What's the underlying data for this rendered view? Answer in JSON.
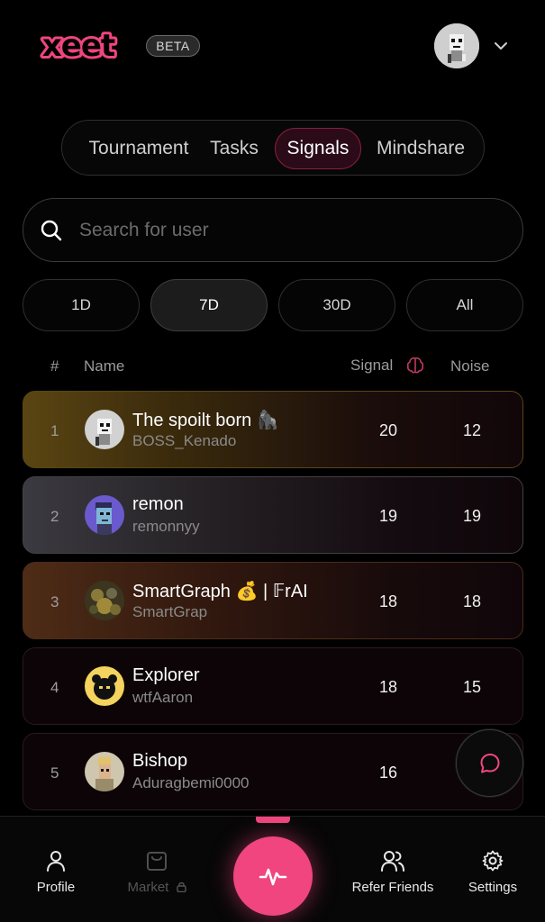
{
  "header": {
    "logo_text": "xeet",
    "beta_label": "BETA",
    "brand_color": "#f0457e",
    "user_avatar_icon": "pixel-skull-avatar",
    "menu_icon": "chevron-down-icon"
  },
  "tabs": [
    {
      "label": "Tournament",
      "active": false
    },
    {
      "label": "Tasks",
      "active": false
    },
    {
      "label": "Signals",
      "active": true
    },
    {
      "label": "Mindshare",
      "active": false
    }
  ],
  "search": {
    "placeholder": "Search for user",
    "value": ""
  },
  "periods": [
    {
      "label": "1D",
      "active": false
    },
    {
      "label": "7D",
      "active": true
    },
    {
      "label": "30D",
      "active": false
    },
    {
      "label": "All",
      "active": false
    }
  ],
  "table": {
    "columns": {
      "rank": "#",
      "name": "Name",
      "signal": "Signal",
      "noise": "Noise"
    },
    "signal_icon": "brain-icon",
    "rows": [
      {
        "rank": "1",
        "name": "The spoilt born 🦍",
        "handle": "BOSS_Kenado",
        "signal": "20",
        "noise": "12"
      },
      {
        "rank": "2",
        "name": "remon",
        "handle": "remonnyy",
        "signal": "19",
        "noise": "19"
      },
      {
        "rank": "3",
        "name": "SmartGraph 💰 | 𝔽rAI",
        "handle": "SmartGrap",
        "signal": "18",
        "noise": "18"
      },
      {
        "rank": "4",
        "name": "Explorer",
        "handle": "wtfAaron",
        "signal": "18",
        "noise": "15"
      },
      {
        "rank": "5",
        "name": "Bishop",
        "handle": "Aduragbemi0000",
        "signal": "16",
        "noise": ""
      }
    ]
  },
  "chat_button": {
    "icon": "chat-bubble-icon"
  },
  "bottom_nav": {
    "items": [
      {
        "label": "Profile",
        "icon": "user-icon"
      },
      {
        "label": "Market",
        "icon": "shopping-bag-icon",
        "disabled": true,
        "lock_icon": "lock-icon"
      },
      {
        "label": "Refer Friends",
        "icon": "users-icon"
      },
      {
        "label": "Settings",
        "icon": "gear-icon"
      }
    ],
    "center_icon": "activity-pulse-icon"
  }
}
